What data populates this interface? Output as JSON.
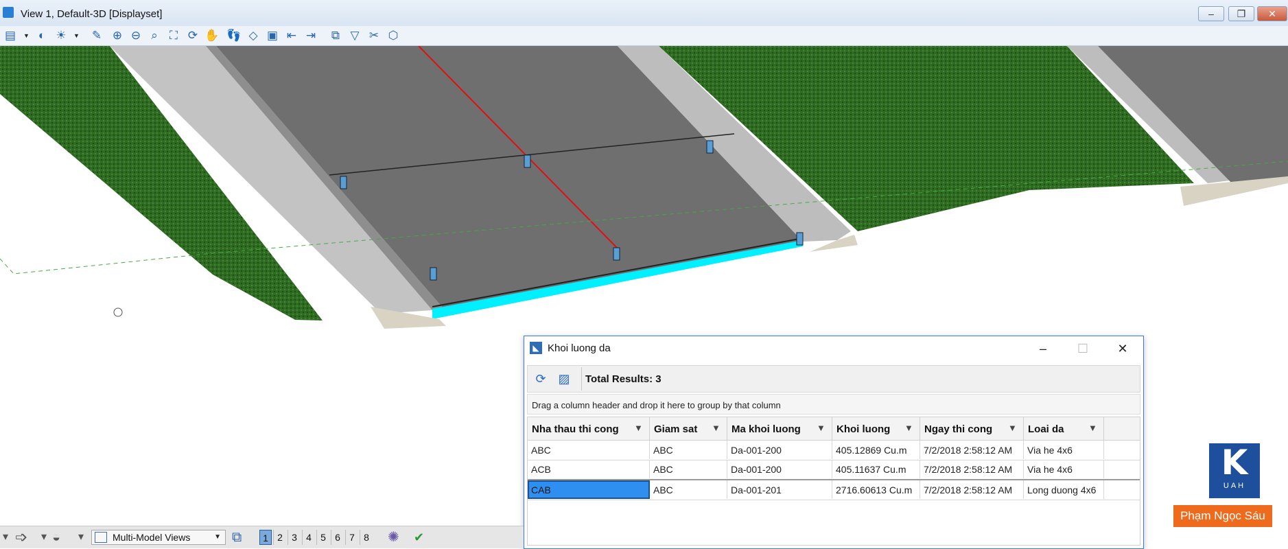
{
  "window": {
    "title": "View 1, Default-3D [Displayset]",
    "buttons": {
      "minimize": "–",
      "restore": "❐",
      "close": "✕"
    }
  },
  "toolbar": {
    "icons": [
      "view-attributes-icon",
      "display-style-icon",
      "lighting-icon",
      "update-view-icon",
      "zoom-in-icon",
      "zoom-out-icon",
      "window-area-icon",
      "fit-view-icon",
      "rotate-view-icon",
      "pan-view-icon",
      "walk-icon",
      "clip-volume-icon",
      "view-previous-icon",
      "view-next-icon",
      "copy-view-icon",
      "camera-icon",
      "clip-icon",
      "fence-icon",
      "section-icon"
    ]
  },
  "dialog": {
    "title": "Khoi luong da",
    "total_results": "Total Results: 3",
    "group_hint": "Drag a column header and drop it here to group by that column",
    "columns": [
      "Nha thau thi cong",
      "Giam sat",
      "Ma khoi luong",
      "Khoi luong",
      "Ngay thi cong",
      "Loai da"
    ],
    "rows": [
      [
        "ABC",
        "ABC",
        "Da-001-200",
        "405.12869 Cu.m",
        "7/2/2018 2:58:12 AM",
        "Via he 4x6"
      ],
      [
        "ACB",
        "ABC",
        "Da-001-200",
        "405.11637 Cu.m",
        "7/2/2018 2:58:12 AM",
        "Via he 4x6"
      ],
      [
        "CAB",
        "ABC",
        "Da-001-201",
        "2716.60613 Cu.m",
        "7/2/2018 2:58:12 AM",
        "Long duong 4x6"
      ]
    ],
    "selected_row": 2
  },
  "viewbar": {
    "view_mode": "Multi-Model Views",
    "views": [
      "1",
      "2",
      "3",
      "4",
      "5",
      "6",
      "7",
      "8"
    ],
    "active_view": "1"
  },
  "watermark": {
    "logo_text": "UAH",
    "author": "Phạm Ngọc Sáu"
  },
  "colors": {
    "grass": "#2f6b22",
    "road": "#6f6f6f",
    "curb": "#bdbdbd",
    "highlight": "#00f0ff",
    "selection": "#2e8ff0"
  }
}
